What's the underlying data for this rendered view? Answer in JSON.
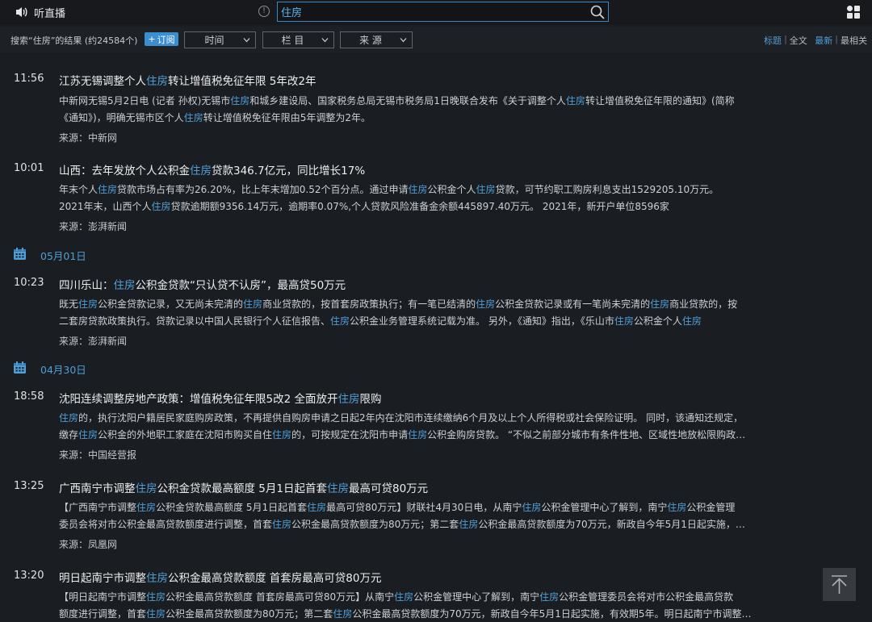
{
  "topbar": {
    "listen_label": "听直播",
    "info_glyph": "!",
    "search_value": "住房",
    "icons": {
      "listen": "speaker-icon",
      "info": "info-icon",
      "search": "search-icon",
      "menu": "grid-icon"
    }
  },
  "filters": {
    "result_count": "搜索“住房”的结果 (约24584个)",
    "subscribe_label": "订阅",
    "time_label": "时间",
    "column_label": "栏 目",
    "source_label": "来 源",
    "view_title": "标题",
    "view_full": "全文",
    "sort_latest": "最新",
    "sort_relevant": "最相关"
  },
  "dates": [
    "05月01日",
    "04月30日"
  ],
  "news": [
    {
      "time": "11:56",
      "title": "江苏无锡调整个人住房转让增值税免征年限 5年改2年",
      "summary": [
        "中新网无锡5月2日电 (记者 孙权)无锡市住房和城乡建设局、国家税务总局无锡市税务局1日晚联合发布《关于调整个人住房转让增值税免征年限的通知》(简称",
        "《通知》)，明确无锡市区个人住房转让增值税免征年限由5年调整为2年。"
      ],
      "source": "来源：中新网"
    },
    {
      "time": "10:01",
      "title": "山西：去年发放个人公积金住房贷款346.7亿元，同比增长17%",
      "summary": [
        "年末个人住房贷款市场占有率为26.20%，比上年末增加0.52个百分点。通过申请住房公积金个人住房贷款，可节约职工购房利息支出1529205.10万元。",
        "2021年末，山西个人住房贷款逾期额9356.14万元，逾期率0.07%,个人贷款风险准备金余额445897.40万元。 2021年，新开户单位8596家"
      ],
      "source": "来源：澎湃新闻"
    },
    {
      "time": "10:23",
      "title": "四川乐山：住房公积金贷款“只认贷不认房”，最高贷50万元",
      "summary": [
        "既无住房公积金贷款记录，又无尚未完清的住房商业贷款的，按首套房政策执行；有一笔已结清的住房公积金贷款记录或有一笔尚未完清的住房商业贷款的，按",
        "二套房贷款政策执行。贷款记录以中国人民银行个人征信报告、住房公积金业务管理系统记载为准。 另外，《通知》指出，《乐山市住房公积金个人住房"
      ],
      "source": "来源：澎湃新闻"
    },
    {
      "time": "18:58",
      "title": "沈阳连续调整房地产政策：增值税免征年限5改2 全面放开住房限购",
      "summary": [
        "住房的，执行沈阳户籍居民家庭购房政策，不再提供自购房申请之日起2年内在沈阳市连续缴纳6个月及以上个人所得税或社会保险证明。 同时，该通知还规定，",
        "缴存住房公积金的外地职工家庭在沈阳市购买自住住房的，可按规定在沈阳市申请住房公积金购房贷款。 “不似之前部分城市有条件性地、区域性地放松限购政…"
      ],
      "source": "来源：中国经营报"
    },
    {
      "time": "13:25",
      "title": "广西南宁市调整住房公积金贷款最高额度 5月1日起首套住房最高可贷80万元",
      "summary": [
        "【广西南宁市调整住房公积金贷款最高额度 5月1日起首套住房最高可贷80万元】财联社4月30日电，从南宁住房公积金管理中心了解到，南宁住房公积金管理",
        "委员会将对市公积金最高贷款额度进行调整，首套住房公积金最高贷款额度为80万元；第二套住房公积金最高贷款额度为70万元，新政自今年5月1日起实施，…"
      ],
      "source": "来源：凤凰网"
    },
    {
      "time": "13:20",
      "title": "明日起南宁市调整住房公积金最高贷款额度 首套房最高可贷80万元",
      "summary": [
        "【明日起南宁市调整住房公积金最高贷款额度 首套房最高可贷80万元】从南宁住房公积金管理中心了解到，南宁住房公积金管理委员会将对市公积金最高贷款",
        "额度进行调整，首套住房公积金最高贷款额度为80万元；第二套住房公积金最高贷款额度为70万元，新政自今年5月1日起实施，有效期5年。明日起南宁市调整…"
      ],
      "source": ""
    }
  ],
  "highlight_term": "住房"
}
